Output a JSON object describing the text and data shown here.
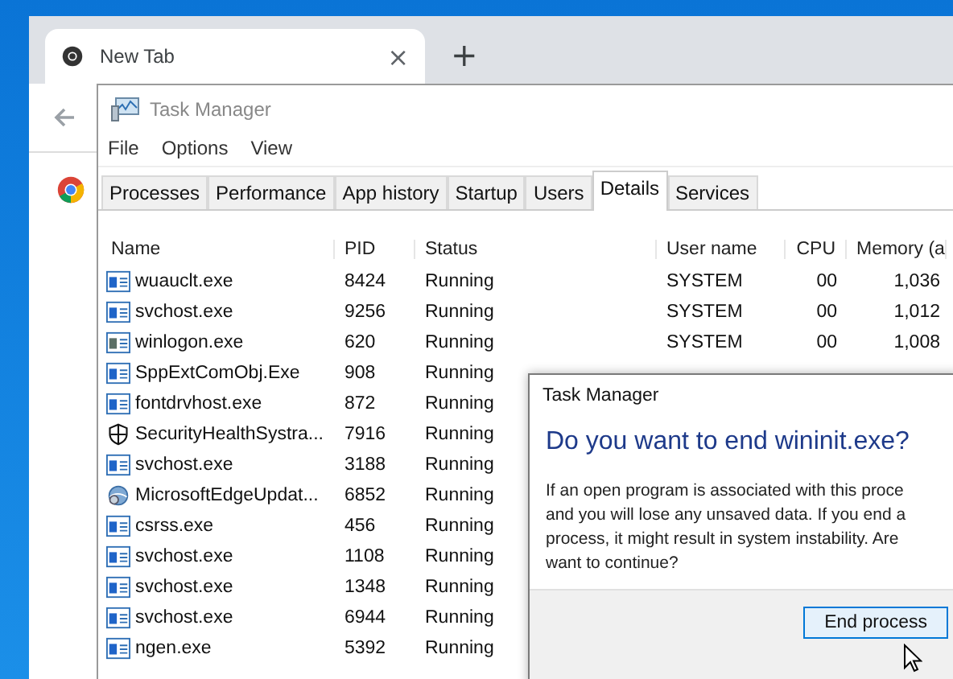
{
  "browser": {
    "tab": {
      "title": "New Tab",
      "close": "×"
    },
    "new_tab": "+"
  },
  "task_manager": {
    "title": "Task Manager",
    "menu": [
      "File",
      "Options",
      "View"
    ],
    "tabs": [
      {
        "label": "Processes",
        "selected": false
      },
      {
        "label": "Performance",
        "selected": false
      },
      {
        "label": "App history",
        "selected": false
      },
      {
        "label": "Startup",
        "selected": false
      },
      {
        "label": "Users",
        "selected": false
      },
      {
        "label": "Details",
        "selected": true
      },
      {
        "label": "Services",
        "selected": false
      }
    ],
    "columns": [
      "Name",
      "PID",
      "Status",
      "User name",
      "CPU",
      "Memory (a"
    ],
    "rows": [
      {
        "kind": "app",
        "name": "wuauclt.exe",
        "pid": "8424",
        "status": "Running",
        "user": "SYSTEM",
        "cpu": "00",
        "memory": "1,036"
      },
      {
        "kind": "app",
        "name": "svchost.exe",
        "pid": "9256",
        "status": "Running",
        "user": "SYSTEM",
        "cpu": "00",
        "memory": "1,012"
      },
      {
        "kind": "logon",
        "name": "winlogon.exe",
        "pid": "620",
        "status": "Running",
        "user": "SYSTEM",
        "cpu": "00",
        "memory": "1,008"
      },
      {
        "kind": "app",
        "name": "SppExtComObj.Exe",
        "pid": "908",
        "status": "Running"
      },
      {
        "kind": "app",
        "name": "fontdrvhost.exe",
        "pid": "872",
        "status": "Running"
      },
      {
        "kind": "security",
        "name": "SecurityHealthSystra...",
        "pid": "7916",
        "status": "Running"
      },
      {
        "kind": "app",
        "name": "svchost.exe",
        "pid": "3188",
        "status": "Running"
      },
      {
        "kind": "updater",
        "name": "MicrosoftEdgeUpdat...",
        "pid": "6852",
        "status": "Running"
      },
      {
        "kind": "app",
        "name": "csrss.exe",
        "pid": "456",
        "status": "Running"
      },
      {
        "kind": "app",
        "name": "svchost.exe",
        "pid": "1108",
        "status": "Running"
      },
      {
        "kind": "app",
        "name": "svchost.exe",
        "pid": "1348",
        "status": "Running"
      },
      {
        "kind": "app",
        "name": "svchost.exe",
        "pid": "6944",
        "status": "Running"
      },
      {
        "kind": "app",
        "name": "ngen.exe",
        "pid": "5392",
        "status": "Running"
      }
    ]
  },
  "dialog": {
    "title": "Task Manager",
    "heading": "Do you want to end wininit.exe?",
    "lines": [
      "If an open program is associated with this proce",
      "and you will lose any unsaved data. If you end a",
      "process, it might result in system instability. Are",
      "want to continue?"
    ],
    "button": "End process"
  }
}
